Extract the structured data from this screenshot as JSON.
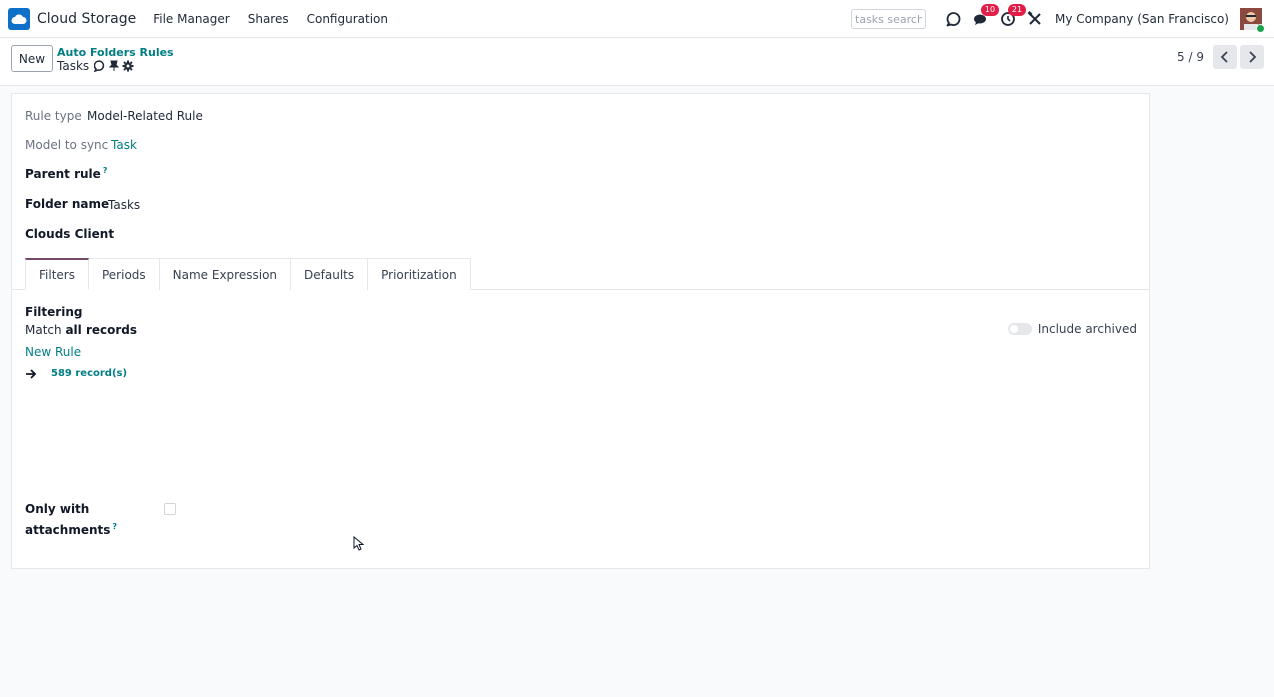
{
  "navbar": {
    "app_name": "Cloud Storage",
    "menu": [
      "File Manager",
      "Shares",
      "Configuration"
    ],
    "search_placeholder": "tasks search",
    "messages_count": "10",
    "activities_count": "21",
    "company": "My Company (San Francisco)",
    "icons": [
      "cloud-storage-logo-icon",
      "sync-icon",
      "chat-bubbles-icon",
      "clock-activity-icon",
      "debug-tools-icon",
      "avatar"
    ]
  },
  "control_panel": {
    "new_label": "New",
    "breadcrumb": "Auto Folders Rules",
    "record_title": "Tasks",
    "pager_value": "5 / 9"
  },
  "form": {
    "rule_type_label": "Rule type",
    "rule_type_value": "Model-Related Rule",
    "model_label": "Model to sync",
    "model_value": "Task",
    "parent_rule_label": "Parent rule",
    "help_mark": "?",
    "folder_name_label": "Folder name",
    "folder_name_value": "Tasks",
    "clouds_client_label": "Clouds Client",
    "tabs": [
      "Filters",
      "Periods",
      "Name Expression",
      "Defaults",
      "Prioritization"
    ],
    "active_tab": "Filters",
    "filtering_title": "Filtering",
    "match_prefix": "Match",
    "match_value": "all records",
    "new_rule": "New Rule",
    "records_count": "589 record(s)",
    "include_archived": "Include archived",
    "attachments_label_1": "Only with",
    "attachments_label_2": "attachments"
  },
  "colors": {
    "accent": "#017e84",
    "brand": "#714b67",
    "badge": "#e11d48"
  }
}
